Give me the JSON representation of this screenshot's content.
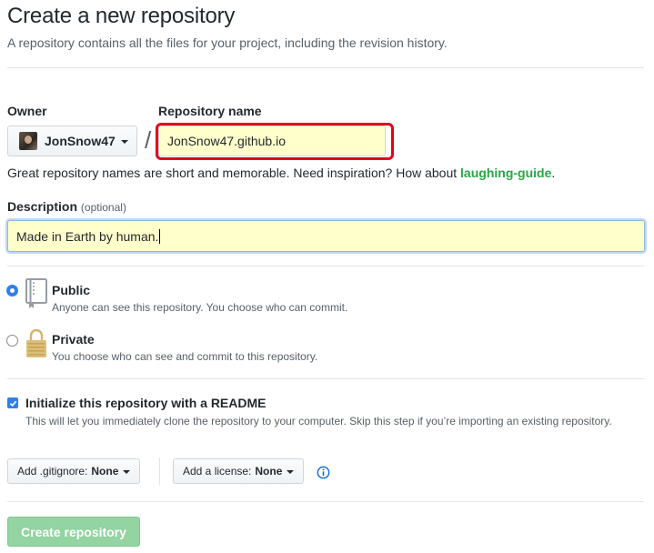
{
  "header": {
    "title": "Create a new repository",
    "subtitle": "A repository contains all the files for your project, including the revision history."
  },
  "owner": {
    "label": "Owner",
    "name": "JonSnow47",
    "avatar_icon": "user-avatar"
  },
  "separator": "/",
  "repository": {
    "label": "Repository name",
    "value": "JonSnow47.github.io",
    "highlight_color": "#e4001a"
  },
  "hint": {
    "text": "Great repository names are short and memorable. Need inspiration? How about ",
    "suggestion": "laughing-guide",
    "end": "."
  },
  "description": {
    "label": "Description",
    "optional": "(optional)",
    "value": "Made in Earth by human."
  },
  "visibility": {
    "selected": "public",
    "public": {
      "title": "Public",
      "desc": "Anyone can see this repository. You choose who can commit.",
      "icon": "repo-book-icon"
    },
    "private": {
      "title": "Private",
      "desc": "You choose who can see and commit to this repository.",
      "icon": "lock-icon"
    }
  },
  "readme": {
    "checked": true,
    "title": "Initialize this repository with a README",
    "desc": "This will let you immediately clone the repository to your computer. Skip this step if you’re importing an existing repository."
  },
  "gitignore": {
    "label": "Add .gitignore:",
    "value": "None"
  },
  "license": {
    "label": "Add a license:",
    "value": "None"
  },
  "create_button": {
    "label": "Create repository",
    "color": "#94d3a2"
  },
  "colors": {
    "text": "#24292e",
    "muted": "#586069",
    "link_green": "#28a745",
    "autofill": "#ffffcc",
    "accent_blue": "#2f80ed"
  }
}
